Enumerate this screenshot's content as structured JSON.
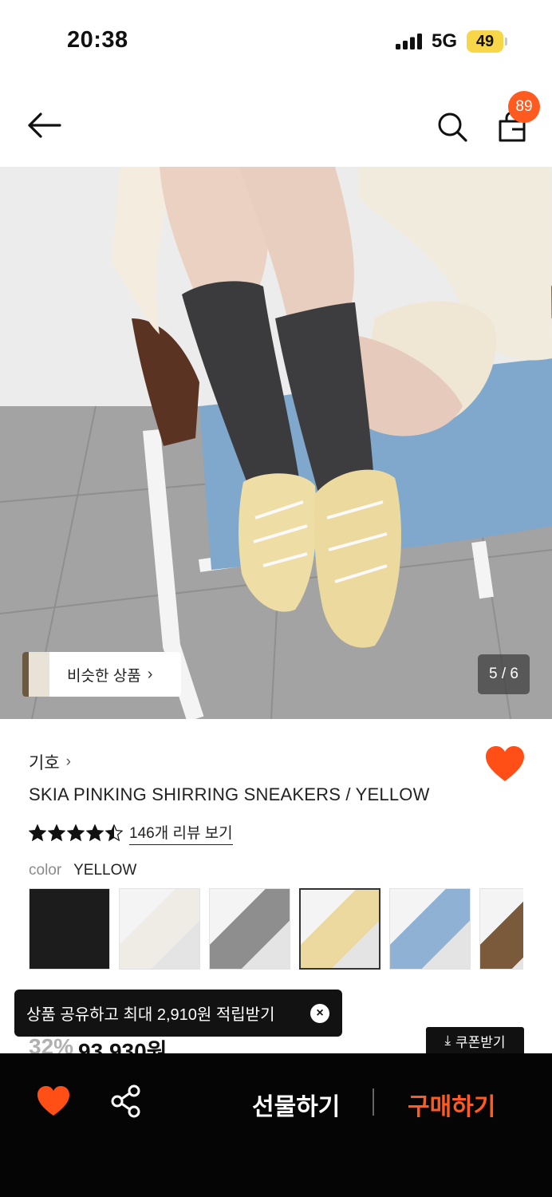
{
  "status_bar": {
    "time": "20:38",
    "network": "5G",
    "battery": "49"
  },
  "header": {
    "cart_count": "89"
  },
  "hero": {
    "similar_label": "비슷한 상품",
    "page_indicator": "5 / 6"
  },
  "product": {
    "brand": "기호",
    "name": "SKIA PINKING SHIRRING SNEAKERS / YELLOW",
    "rating": 4.5,
    "rating_max": 5,
    "review_link": "146개 리뷰 보기",
    "color_label": "color",
    "color_value": "YELLOW",
    "swatches": [
      {
        "name": "black",
        "color": "#1c1c1c"
      },
      {
        "name": "white",
        "color": "#efece6"
      },
      {
        "name": "grey",
        "color": "#8e8e8e"
      },
      {
        "name": "yellow",
        "color": "#ecd9a0"
      },
      {
        "name": "blue",
        "color": "#8fb1d3"
      },
      {
        "name": "brown",
        "color": "#7a5a3a"
      }
    ],
    "selected_swatch": 3,
    "discount": "32%",
    "price": "93,930원",
    "coupon_label": "쿠폰받기"
  },
  "toast": {
    "text": "상품 공유하고 최대 2,910원 적립받기"
  },
  "bottom_bar": {
    "gift_label": "선물하기",
    "buy_label": "구매하기"
  },
  "colors": {
    "accent": "#ff5a1f",
    "bar_bg": "#050505"
  }
}
